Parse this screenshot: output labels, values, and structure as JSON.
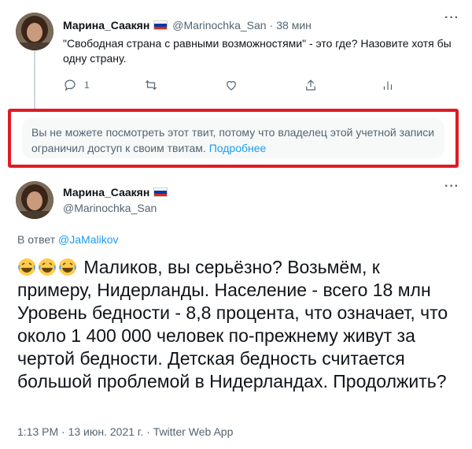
{
  "tweet1": {
    "name": "Марина_Саакян",
    "handle": "@Marinochka_San",
    "separator": "·",
    "time": "38 мин",
    "text": "\"Свободная страна с равными возможностями\" - это где? Назовите хотя бы одну страну.",
    "reply_count": "1",
    "more_label": "···"
  },
  "restricted_notice": {
    "text": "Вы не можете посмотреть этот твит, потому что владелец этой учетной записи ограничил доступ к своим твитам.",
    "link": "Подробнее",
    "highlight_color": "#e01b24"
  },
  "tweet2": {
    "name": "Марина_Саакян",
    "handle": "@Marinochka_San",
    "reply_prefix": "В ответ",
    "reply_to": "@JaMalikov",
    "text": "Маликов, вы серьёзно? Возьмём, к примеру, Нидерланды. Население - всего 18 млн Уровень бедности - 8,8 процента, что означает, что около 1 400 000 человек по-прежнему живут за чертой бедности. Детская бедность считается большой проблемой в Нидерландах. Продолжить?",
    "emojis": [
      "joy-emoji",
      "joy-emoji",
      "joy-emoji"
    ],
    "time": "1:13 PM",
    "date": "13 июн. 2021 г.",
    "source": "Twitter Web App",
    "separator": "·",
    "more_label": "···"
  },
  "colors": {
    "link": "#1d9bf0",
    "muted": "#536471",
    "text": "#0f1419",
    "notice_bg": "#f7f9f9"
  },
  "icons": [
    "reply-icon",
    "retweet-icon",
    "like-icon",
    "share-icon",
    "analytics-icon",
    "russia-flag-icon"
  ]
}
